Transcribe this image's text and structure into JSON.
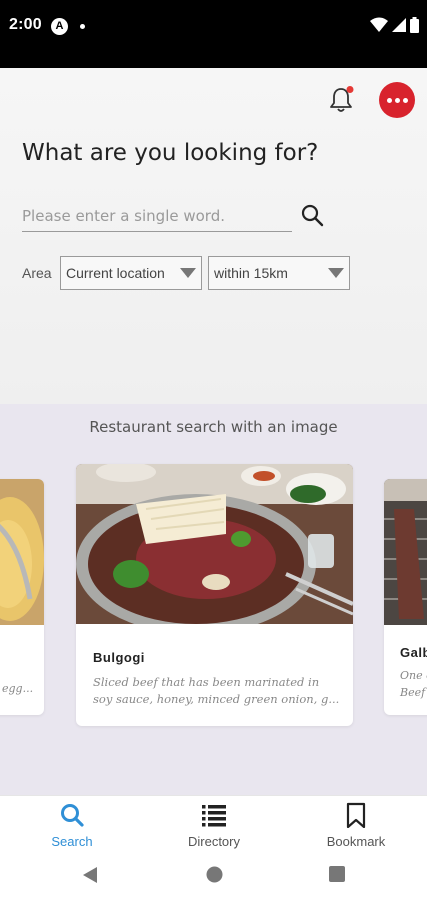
{
  "status_bar": {
    "time": "2:00",
    "app_badge": "A"
  },
  "header": {
    "notification_icon": "bell-icon",
    "notification_badge_color": "#e53935",
    "more_icon": "more-horizontal-icon",
    "more_button_color": "#d8232d"
  },
  "search": {
    "headline": "What are you looking for?",
    "placeholder": "Please enter a single word.",
    "value": "",
    "area_label": "Area",
    "location_value": "Current location",
    "distance_value": "within 15km"
  },
  "image_search": {
    "title": "Restaurant search with an image",
    "cards": [
      {
        "name": "",
        "desc": "egg..."
      },
      {
        "name": "Bulgogi",
        "desc": "Sliced beef that has been marinated in\nsoy sauce, honey, minced green onion, g..."
      },
      {
        "name": "Galb",
        "desc": "One c\nBeef o"
      }
    ]
  },
  "bottom_nav": {
    "items": [
      {
        "label": "Search",
        "icon": "search-icon",
        "active": true
      },
      {
        "label": "Directory",
        "icon": "list-icon",
        "active": false
      },
      {
        "label": "Bookmark",
        "icon": "bookmark-icon",
        "active": false
      }
    ],
    "active_color": "#2f8fd6"
  },
  "system_nav": {
    "icons": [
      "back-icon",
      "home-icon",
      "recents-icon"
    ]
  }
}
